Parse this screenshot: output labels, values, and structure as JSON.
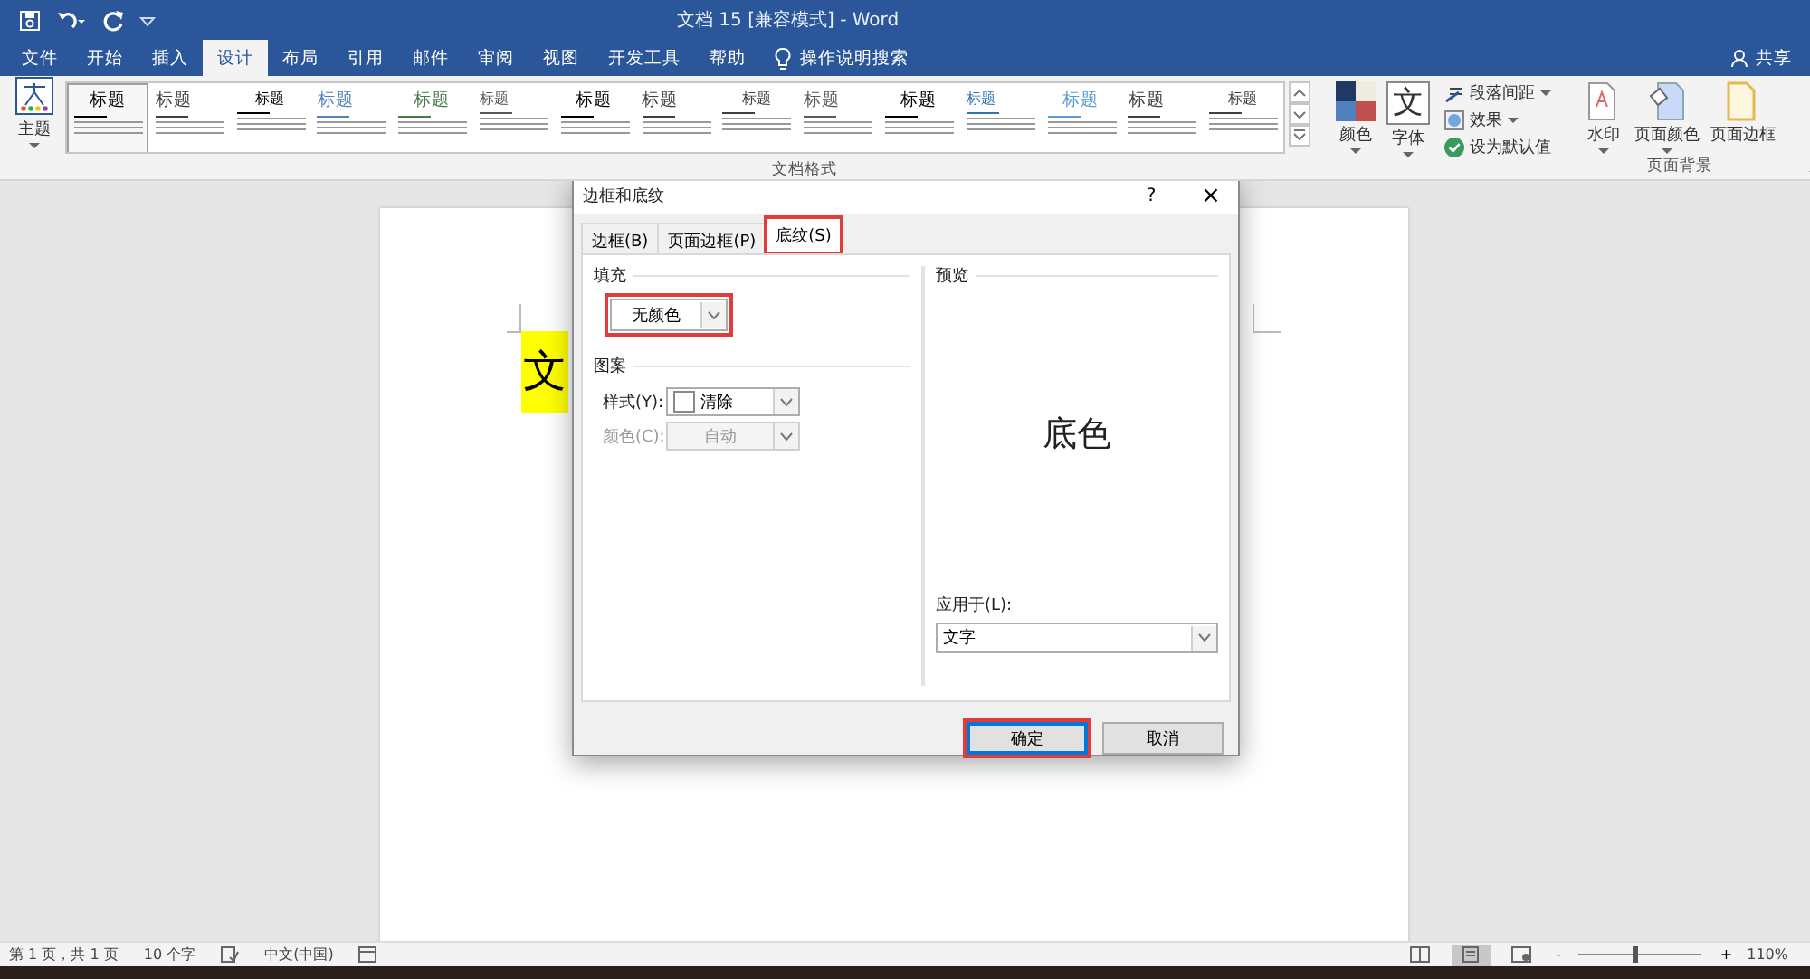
{
  "window": {
    "title": "文档 15 [兼容模式] - Word"
  },
  "ribbon_tabs": [
    {
      "label": "文件",
      "selected": false
    },
    {
      "label": "开始",
      "selected": false
    },
    {
      "label": "插入",
      "selected": false
    },
    {
      "label": "设计",
      "selected": true
    },
    {
      "label": "布局",
      "selected": false
    },
    {
      "label": "引用",
      "selected": false
    },
    {
      "label": "邮件",
      "selected": false
    },
    {
      "label": "审阅",
      "selected": false
    },
    {
      "label": "视图",
      "selected": false
    },
    {
      "label": "开发工具",
      "selected": false
    },
    {
      "label": "帮助",
      "selected": false
    }
  ],
  "tell_me": "操作说明搜索",
  "share": "共享",
  "ribbon": {
    "theme": "主题",
    "gallery": [
      {
        "heading": "标题",
        "color": "#000000",
        "selected": true
      },
      {
        "heading": "标题",
        "color": "#404040",
        "selected": false
      },
      {
        "heading": "标题",
        "color": "#000000",
        "selected": false
      },
      {
        "heading": "标题",
        "color": "#4f81bd",
        "selected": false
      },
      {
        "heading": "标题",
        "color": "#4a7a4a",
        "selected": false
      },
      {
        "heading": "标题",
        "color": "#595959",
        "selected": false
      },
      {
        "heading": "标题",
        "color": "#000000",
        "selected": false
      },
      {
        "heading": "标题",
        "color": "#404040",
        "selected": false
      },
      {
        "heading": "标题",
        "color": "#404040",
        "selected": false
      },
      {
        "heading": "标题",
        "color": "#595959",
        "selected": false
      },
      {
        "heading": "标题",
        "color": "#000000",
        "selected": false
      },
      {
        "heading": "标题",
        "color": "#2e74b5",
        "selected": false
      },
      {
        "heading": "标题",
        "color": "#5b9bd5",
        "selected": false
      },
      {
        "heading": "标题",
        "color": "#404040",
        "selected": false
      },
      {
        "heading": "标题",
        "color": "#404040",
        "selected": false
      }
    ],
    "gallery_label": "文档格式",
    "colors": "颜色",
    "fonts": "字体",
    "font_glyph": "文",
    "paragraph_spacing": "段落间距",
    "effects": "效果",
    "set_default": "设为默认值",
    "watermark": "水印",
    "page_color": "页面颜色",
    "page_borders": "页面边框",
    "background_label": "页面背景"
  },
  "document": {
    "text": "文",
    "highlighted": true
  },
  "dialog": {
    "title": "边框和底纹",
    "help": "?",
    "close": "×",
    "tabs": [
      {
        "label": "边框(B)",
        "selected": false,
        "highlighted": false
      },
      {
        "label": "页面边框(P)",
        "selected": false,
        "highlighted": false
      },
      {
        "label": "底纹(S)",
        "selected": true,
        "highlighted": true
      }
    ],
    "fill": {
      "label": "填充",
      "value": "无颜色",
      "highlighted": true
    },
    "pattern": {
      "label": "图案",
      "style": {
        "label": "样式(Y):",
        "value": "清除",
        "disabled": false
      },
      "color": {
        "label": "颜色(C):",
        "value": "自动",
        "disabled": true
      }
    },
    "preview": {
      "label": "预览",
      "sample": "底色",
      "apply_label": "应用于(L):",
      "apply_value": "文字"
    },
    "buttons": [
      {
        "label": "确定",
        "default": true,
        "highlighted": true
      },
      {
        "label": "取消",
        "default": false,
        "highlighted": false
      }
    ]
  },
  "status_bar": {
    "page": "第 1 页，共 1 页",
    "words": "10 个字",
    "language": "中文(中国)",
    "views": [
      {
        "kind": "read",
        "selected": false
      },
      {
        "kind": "print",
        "selected": true
      },
      {
        "kind": "web",
        "selected": false
      }
    ],
    "zoom_minus": "-",
    "zoom_slider": {
      "level": 0.45
    },
    "zoom_plus": "+",
    "zoom": "110%"
  }
}
